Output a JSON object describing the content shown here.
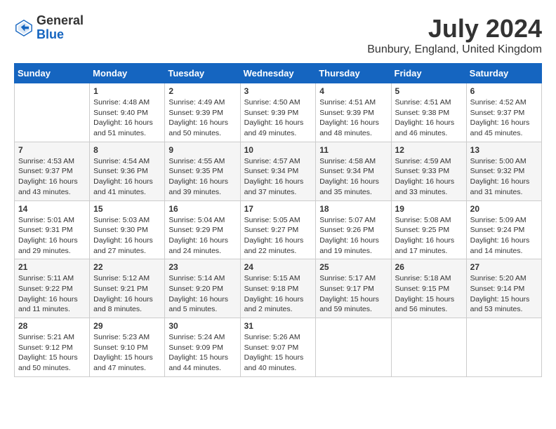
{
  "header": {
    "logo_general": "General",
    "logo_blue": "Blue",
    "month_title": "July 2024",
    "location": "Bunbury, England, United Kingdom"
  },
  "weekdays": [
    "Sunday",
    "Monday",
    "Tuesday",
    "Wednesday",
    "Thursday",
    "Friday",
    "Saturday"
  ],
  "weeks": [
    [
      {
        "day": "",
        "content": ""
      },
      {
        "day": "1",
        "content": "Sunrise: 4:48 AM\nSunset: 9:40 PM\nDaylight: 16 hours\nand 51 minutes."
      },
      {
        "day": "2",
        "content": "Sunrise: 4:49 AM\nSunset: 9:39 PM\nDaylight: 16 hours\nand 50 minutes."
      },
      {
        "day": "3",
        "content": "Sunrise: 4:50 AM\nSunset: 9:39 PM\nDaylight: 16 hours\nand 49 minutes."
      },
      {
        "day": "4",
        "content": "Sunrise: 4:51 AM\nSunset: 9:39 PM\nDaylight: 16 hours\nand 48 minutes."
      },
      {
        "day": "5",
        "content": "Sunrise: 4:51 AM\nSunset: 9:38 PM\nDaylight: 16 hours\nand 46 minutes."
      },
      {
        "day": "6",
        "content": "Sunrise: 4:52 AM\nSunset: 9:37 PM\nDaylight: 16 hours\nand 45 minutes."
      }
    ],
    [
      {
        "day": "7",
        "content": "Sunrise: 4:53 AM\nSunset: 9:37 PM\nDaylight: 16 hours\nand 43 minutes."
      },
      {
        "day": "8",
        "content": "Sunrise: 4:54 AM\nSunset: 9:36 PM\nDaylight: 16 hours\nand 41 minutes."
      },
      {
        "day": "9",
        "content": "Sunrise: 4:55 AM\nSunset: 9:35 PM\nDaylight: 16 hours\nand 39 minutes."
      },
      {
        "day": "10",
        "content": "Sunrise: 4:57 AM\nSunset: 9:34 PM\nDaylight: 16 hours\nand 37 minutes."
      },
      {
        "day": "11",
        "content": "Sunrise: 4:58 AM\nSunset: 9:34 PM\nDaylight: 16 hours\nand 35 minutes."
      },
      {
        "day": "12",
        "content": "Sunrise: 4:59 AM\nSunset: 9:33 PM\nDaylight: 16 hours\nand 33 minutes."
      },
      {
        "day": "13",
        "content": "Sunrise: 5:00 AM\nSunset: 9:32 PM\nDaylight: 16 hours\nand 31 minutes."
      }
    ],
    [
      {
        "day": "14",
        "content": "Sunrise: 5:01 AM\nSunset: 9:31 PM\nDaylight: 16 hours\nand 29 minutes."
      },
      {
        "day": "15",
        "content": "Sunrise: 5:03 AM\nSunset: 9:30 PM\nDaylight: 16 hours\nand 27 minutes."
      },
      {
        "day": "16",
        "content": "Sunrise: 5:04 AM\nSunset: 9:29 PM\nDaylight: 16 hours\nand 24 minutes."
      },
      {
        "day": "17",
        "content": "Sunrise: 5:05 AM\nSunset: 9:27 PM\nDaylight: 16 hours\nand 22 minutes."
      },
      {
        "day": "18",
        "content": "Sunrise: 5:07 AM\nSunset: 9:26 PM\nDaylight: 16 hours\nand 19 minutes."
      },
      {
        "day": "19",
        "content": "Sunrise: 5:08 AM\nSunset: 9:25 PM\nDaylight: 16 hours\nand 17 minutes."
      },
      {
        "day": "20",
        "content": "Sunrise: 5:09 AM\nSunset: 9:24 PM\nDaylight: 16 hours\nand 14 minutes."
      }
    ],
    [
      {
        "day": "21",
        "content": "Sunrise: 5:11 AM\nSunset: 9:22 PM\nDaylight: 16 hours\nand 11 minutes."
      },
      {
        "day": "22",
        "content": "Sunrise: 5:12 AM\nSunset: 9:21 PM\nDaylight: 16 hours\nand 8 minutes."
      },
      {
        "day": "23",
        "content": "Sunrise: 5:14 AM\nSunset: 9:20 PM\nDaylight: 16 hours\nand 5 minutes."
      },
      {
        "day": "24",
        "content": "Sunrise: 5:15 AM\nSunset: 9:18 PM\nDaylight: 16 hours\nand 2 minutes."
      },
      {
        "day": "25",
        "content": "Sunrise: 5:17 AM\nSunset: 9:17 PM\nDaylight: 15 hours\nand 59 minutes."
      },
      {
        "day": "26",
        "content": "Sunrise: 5:18 AM\nSunset: 9:15 PM\nDaylight: 15 hours\nand 56 minutes."
      },
      {
        "day": "27",
        "content": "Sunrise: 5:20 AM\nSunset: 9:14 PM\nDaylight: 15 hours\nand 53 minutes."
      }
    ],
    [
      {
        "day": "28",
        "content": "Sunrise: 5:21 AM\nSunset: 9:12 PM\nDaylight: 15 hours\nand 50 minutes."
      },
      {
        "day": "29",
        "content": "Sunrise: 5:23 AM\nSunset: 9:10 PM\nDaylight: 15 hours\nand 47 minutes."
      },
      {
        "day": "30",
        "content": "Sunrise: 5:24 AM\nSunset: 9:09 PM\nDaylight: 15 hours\nand 44 minutes."
      },
      {
        "day": "31",
        "content": "Sunrise: 5:26 AM\nSunset: 9:07 PM\nDaylight: 15 hours\nand 40 minutes."
      },
      {
        "day": "",
        "content": ""
      },
      {
        "day": "",
        "content": ""
      },
      {
        "day": "",
        "content": ""
      }
    ]
  ]
}
